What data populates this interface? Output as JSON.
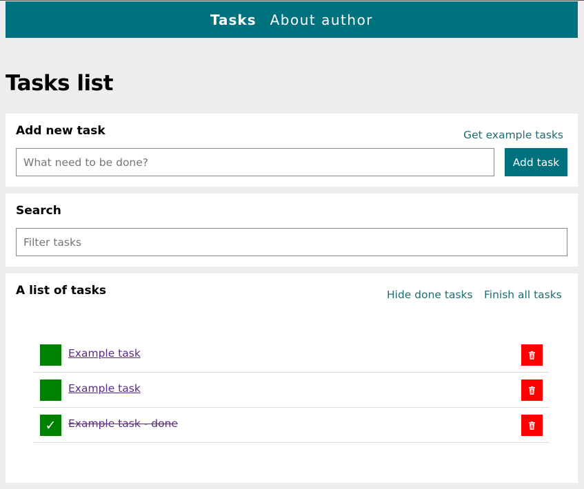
{
  "nav": {
    "tasks_label": "Tasks",
    "about_label": "About author"
  },
  "page_title": "Tasks list",
  "add_section": {
    "heading": "Add new task",
    "example_link": "Get example tasks",
    "input_placeholder": "What need to be done?",
    "input_value": "",
    "button_label": "Add task"
  },
  "search_section": {
    "heading": "Search",
    "input_placeholder": "Filter tasks",
    "input_value": ""
  },
  "list_section": {
    "heading": "A list of tasks",
    "hide_done_link": "Hide done tasks",
    "finish_all_link": "Finish all tasks",
    "tasks": [
      {
        "name": "Example task",
        "done": false,
        "checkmark": ""
      },
      {
        "name": "Example task",
        "done": false,
        "checkmark": ""
      },
      {
        "name": "Example task - done",
        "done": true,
        "checkmark": "✓"
      }
    ]
  },
  "icons": {
    "delete": "trash-icon",
    "done": "checkmark-icon"
  },
  "colors": {
    "accent": "#00717f",
    "check_bg": "#008000",
    "delete_bg": "#ff0000",
    "page_bg": "#ededed",
    "task_link": "#5a2a86"
  }
}
